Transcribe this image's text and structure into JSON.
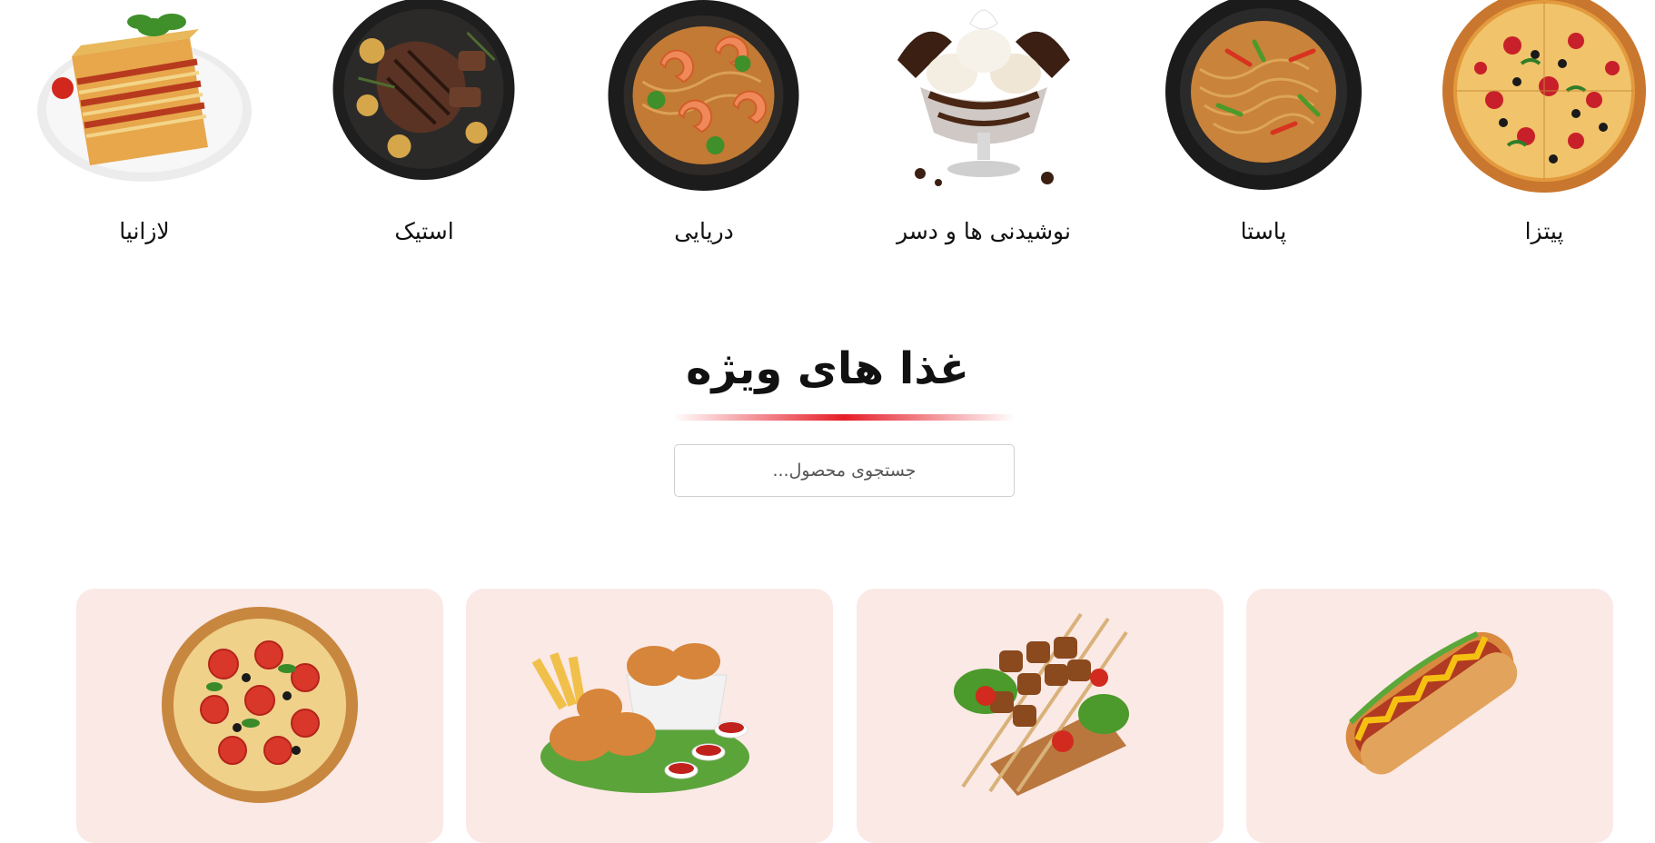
{
  "categories": [
    {
      "label": "پیتزا",
      "icon": "pizza-image"
    },
    {
      "label": "پاستا",
      "icon": "pasta-image"
    },
    {
      "label": "نوشیدنی ها و دسر",
      "icon": "ice-cream-dessert-image"
    },
    {
      "label": "دریایی",
      "icon": "seafood-shrimp-image"
    },
    {
      "label": "استیک",
      "icon": "steak-image"
    },
    {
      "label": "لازانیا",
      "icon": "lasagna-image"
    }
  ],
  "section": {
    "title": "غذا های ویژه",
    "accent_color": "#e61e28"
  },
  "search": {
    "placeholder": "جستجوی محصول...",
    "value": ""
  },
  "products": [
    {
      "icon": "hotdog-image"
    },
    {
      "icon": "kebab-skewers-image"
    },
    {
      "icon": "fried-chicken-image"
    },
    {
      "icon": "pizza-image"
    }
  ],
  "colors": {
    "card_background": "#fbe9e6",
    "text": "#111111"
  }
}
